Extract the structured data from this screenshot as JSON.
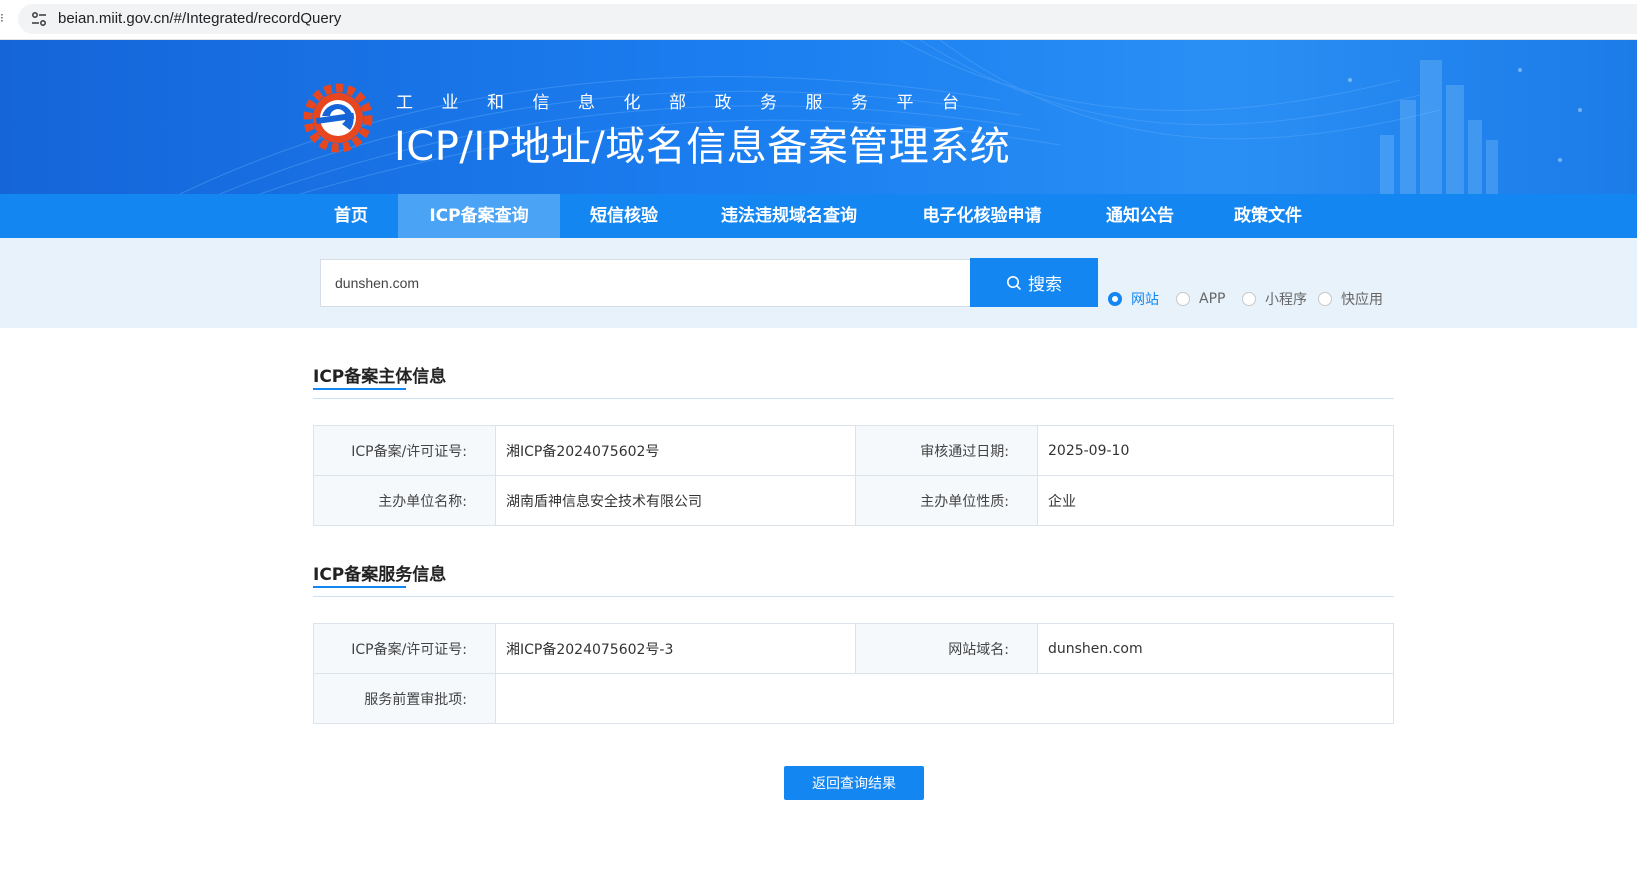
{
  "browser": {
    "url": "beian.miit.gov.cn/#/Integrated/recordQuery"
  },
  "header": {
    "subtitle": "工业和信息化部政务服务平台",
    "title": "ICP/IP地址/域名信息备案管理系统"
  },
  "nav": {
    "items": [
      {
        "label": "首页"
      },
      {
        "label": "ICP备案查询"
      },
      {
        "label": "短信核验"
      },
      {
        "label": "违法违规域名查询"
      },
      {
        "label": "电子化核验申请"
      },
      {
        "label": "通知公告"
      },
      {
        "label": "政策文件"
      }
    ],
    "active_index": 1
  },
  "search": {
    "value": "dunshen.com",
    "button_label": "搜索",
    "types": [
      {
        "label": "网站",
        "checked": true
      },
      {
        "label": "APP",
        "checked": false
      },
      {
        "label": "小程序",
        "checked": false
      },
      {
        "label": "快应用",
        "checked": false
      }
    ]
  },
  "subject_info": {
    "title": "ICP备案主体信息",
    "license_label": "ICP备案/许可证号:",
    "license_value": "湘ICP备2024075602号",
    "approval_date_label": "审核通过日期:",
    "approval_date_value": "2025-09-10",
    "org_name_label": "主办单位名称:",
    "org_name_value": "湖南盾神信息安全技术有限公司",
    "org_type_label": "主办单位性质:",
    "org_type_value": "企业"
  },
  "service_info": {
    "title": "ICP备案服务信息",
    "license_label": "ICP备案/许可证号:",
    "license_value": "湘ICP备2024075602号-3",
    "domain_label": "网站域名:",
    "domain_value": "dunshen.com",
    "pre_approval_label": "服务前置审批项:",
    "pre_approval_value": ""
  },
  "actions": {
    "back_label": "返回查询结果"
  },
  "colors": {
    "primary": "#1486f2",
    "nav_active": "#4aa3f5",
    "search_band": "#e8f2fb",
    "label_cell": "#f6f9fc"
  },
  "icons": {
    "site_info": "tune-icon",
    "search": "search-icon",
    "logo": "miit-gear-logo"
  }
}
